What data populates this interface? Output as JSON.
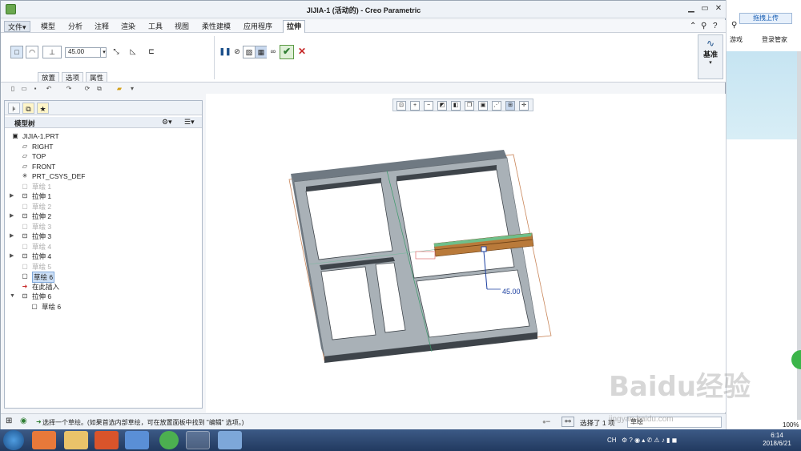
{
  "window": {
    "title": "JIJIA-1 (活动的) - Creo Parametric",
    "min": "▭",
    "max": "▭",
    "close": "✕"
  },
  "menu": {
    "items": [
      "文件",
      "模型",
      "分析",
      "注释",
      "渲染",
      "工具",
      "视图",
      "柔性建模",
      "应用程序",
      "拉伸"
    ],
    "file_arrow": "▾"
  },
  "ribbon": {
    "depth_value": "45.00",
    "subtabs": [
      "放置",
      "选项",
      "属性"
    ],
    "datum_label": "基准",
    "datum_arrow": "▾"
  },
  "model_tree": {
    "title": "模型树",
    "items": [
      {
        "label": "JIJIA-1.PRT",
        "state": "normal",
        "expand": ""
      },
      {
        "label": "RIGHT",
        "state": "normal",
        "expand": ""
      },
      {
        "label": "TOP",
        "state": "normal",
        "expand": ""
      },
      {
        "label": "FRONT",
        "state": "normal",
        "expand": ""
      },
      {
        "label": "PRT_CSYS_DEF",
        "state": "normal",
        "expand": ""
      },
      {
        "label": "草绘 1",
        "state": "dim",
        "expand": ""
      },
      {
        "label": "拉伸 1",
        "state": "normal",
        "expand": "▶"
      },
      {
        "label": "草绘 2",
        "state": "dim",
        "expand": ""
      },
      {
        "label": "拉伸 2",
        "state": "normal",
        "expand": "▶"
      },
      {
        "label": "草绘 3",
        "state": "dim",
        "expand": ""
      },
      {
        "label": "拉伸 3",
        "state": "normal",
        "expand": "▶"
      },
      {
        "label": "草绘 4",
        "state": "dim",
        "expand": ""
      },
      {
        "label": "拉伸 4",
        "state": "normal",
        "expand": "▶"
      },
      {
        "label": "草绘 5",
        "state": "dim",
        "expand": ""
      },
      {
        "label": "草绘 6",
        "state": "selected",
        "expand": ""
      },
      {
        "label": "在此插入",
        "state": "normal",
        "expand": ""
      },
      {
        "label": "拉伸 6",
        "state": "normal",
        "expand": "▼"
      },
      {
        "label": "草绘 6",
        "state": "normal",
        "expand": ""
      }
    ]
  },
  "viewport": {
    "dimension_value": "45.00"
  },
  "status": {
    "message": "选择一个草绘。(如果首选内部草绘，可在放置面板中找到 \"编辑\" 选项。)",
    "selected_count": "选择了 1 项",
    "filter_value": "草绘"
  },
  "browser": {
    "upload_label": "拖拽上传",
    "games_label": "游戏",
    "login_label": "登录管家",
    "zoom": "100%"
  },
  "taskbar": {
    "time": "6:14",
    "date": "2018/6/21",
    "lang": "CH"
  },
  "watermark": {
    "text": "Baidu经验",
    "url": "jingyan.baidu.com"
  }
}
